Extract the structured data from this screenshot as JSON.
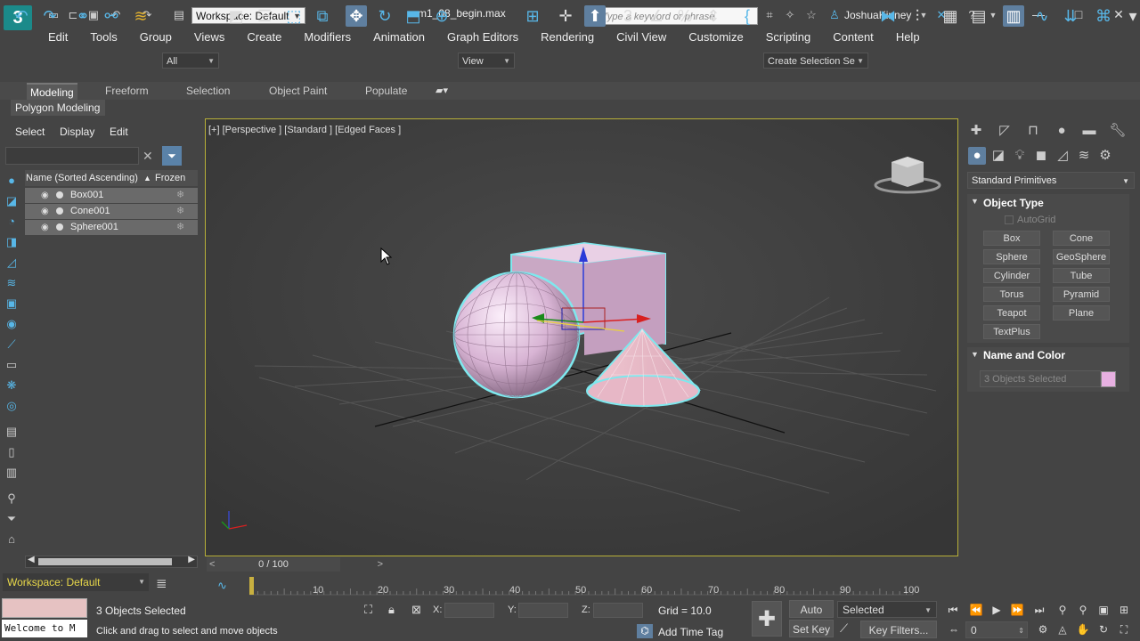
{
  "titlebar": {
    "workspace": "Workspace: Default",
    "file_title": "m1_08_begin.max",
    "search_placeholder": "Type a keyword or phrase",
    "user": "JoshuaKinney"
  },
  "menu": [
    "Edit",
    "Tools",
    "Group",
    "Views",
    "Create",
    "Modifiers",
    "Animation",
    "Graph Editors",
    "Rendering",
    "Civil View",
    "Customize",
    "Scripting",
    "Content",
    "Help"
  ],
  "toolbar": {
    "filter_value": "All",
    "view_value": "View",
    "selection_set": "Create Selection Se"
  },
  "ribbon": {
    "tabs": [
      "Modeling",
      "Freeform",
      "Selection",
      "Object Paint",
      "Populate"
    ],
    "active_tab": "Modeling",
    "sub_label": "Polygon Modeling"
  },
  "explorer": {
    "tabs": [
      "Select",
      "Display",
      "Edit"
    ],
    "col_name": "Name (Sorted Ascending)",
    "col_frozen": "Frozen",
    "rows": [
      "Box001",
      "Cone001",
      "Sphere001"
    ],
    "workspace": "Workspace: Default"
  },
  "viewport": {
    "label": "[+] [Perspective ] [Standard ] [Edged Faces ]"
  },
  "command_panel": {
    "dropdown": "Standard Primitives",
    "object_type_title": "Object Type",
    "autogrid": "AutoGrid",
    "buttons": [
      "Box",
      "Cone",
      "Sphere",
      "GeoSphere",
      "Cylinder",
      "Tube",
      "Torus",
      "Pyramid",
      "Teapot",
      "Plane",
      "TextPlus"
    ],
    "name_color_title": "Name and Color",
    "name_value": "3 Objects Selected",
    "swatch_color": "#e7b0e1"
  },
  "timeline": {
    "slider_label": "0 / 100",
    "ticks": [
      "10",
      "20",
      "30",
      "40",
      "50",
      "60",
      "70",
      "80",
      "90",
      "100"
    ]
  },
  "status": {
    "selected": "3 Objects Selected",
    "hint": "Click and drag to select and move objects",
    "maxscript": "Welcome to M",
    "x_label": "X:",
    "y_label": "Y:",
    "z_label": "Z:",
    "grid": "Grid = 10.0",
    "add_time_tag": "Add Time Tag",
    "auto_key": "Auto Key",
    "set_key": "Set Key",
    "key_mode": "Selected",
    "key_filters": "Key Filters...",
    "frame": "0"
  }
}
